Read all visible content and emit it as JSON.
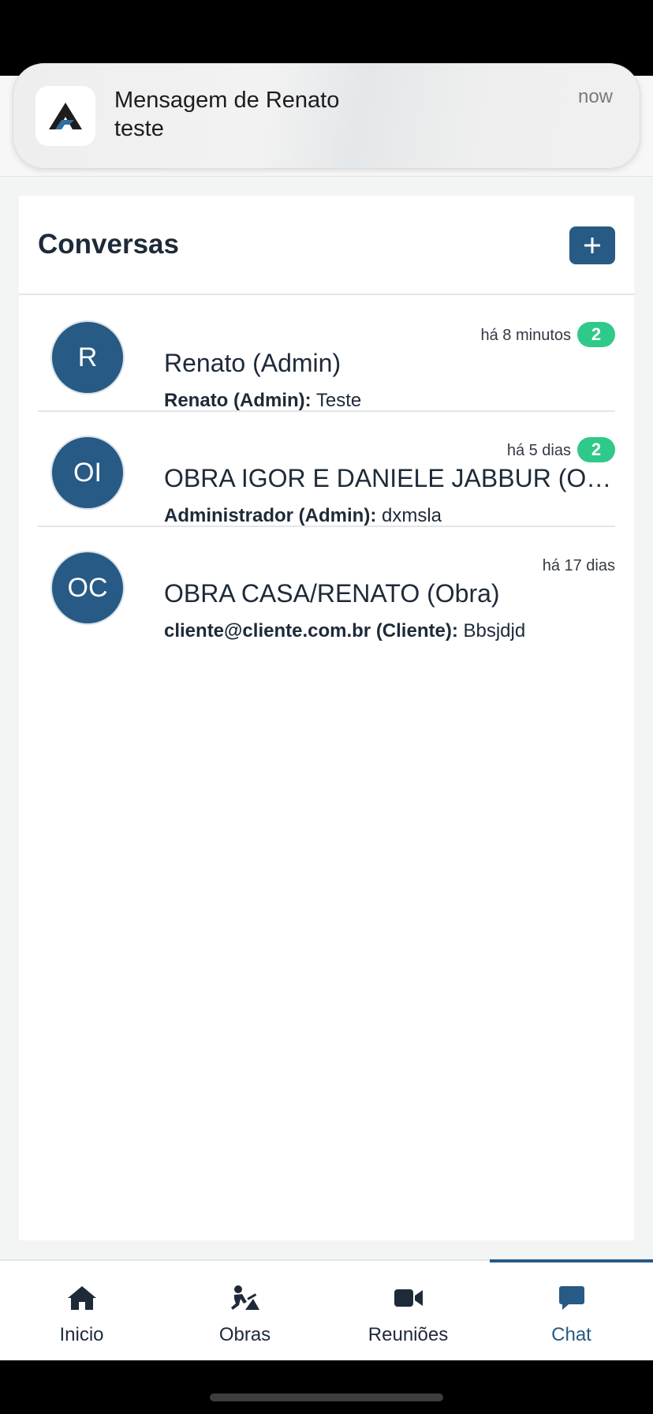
{
  "notification": {
    "title": "Mensagem de Renato",
    "body": "teste",
    "time": "now",
    "app_icon": "app-logo-icon"
  },
  "header": {
    "title": "Conversas",
    "add_icon": "plus-icon"
  },
  "conversations": [
    {
      "initials": "R",
      "name": "Renato (Admin)",
      "time": "há 8 minutos",
      "unread": "2",
      "sender": "Renato (Admin):",
      "message": "Teste"
    },
    {
      "initials": "OI",
      "name": "OBRA IGOR E DANIELE JABBUR (Obra)",
      "time": "há 5 dias",
      "unread": "2",
      "sender": "Administrador (Admin):",
      "message": "dxmsla"
    },
    {
      "initials": "OC",
      "name": "OBRA CASA/RENATO (Obra)",
      "time": "há 17 dias",
      "unread": "",
      "sender": "cliente@cliente.com.br (Cliente):",
      "message": "Bbsjdjd"
    }
  ],
  "tabs": [
    {
      "label": "Inicio",
      "icon": "home-icon"
    },
    {
      "label": "Obras",
      "icon": "construction-worker-icon"
    },
    {
      "label": "Reuniões",
      "icon": "video-camera-icon"
    },
    {
      "label": "Chat",
      "icon": "chat-bubble-icon",
      "active": true
    }
  ],
  "colors": {
    "primary": "#275a84",
    "badge": "#2fc98a",
    "text": "#1e2a38"
  }
}
